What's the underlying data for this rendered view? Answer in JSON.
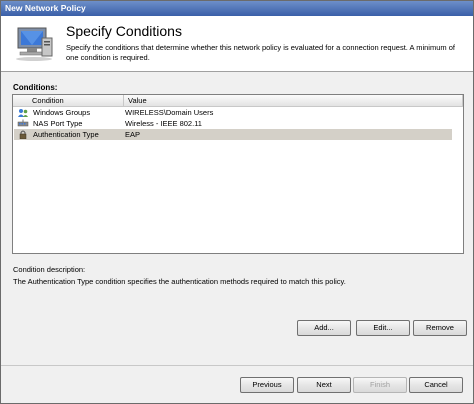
{
  "window": {
    "title": "New Network Policy"
  },
  "header": {
    "title": "Specify Conditions",
    "description": "Specify the conditions that determine whether this network policy is evaluated for a connection request. A minimum of one condition is required."
  },
  "conditions": {
    "label": "Conditions:",
    "columns": [
      "Condition",
      "Value"
    ],
    "rows": [
      {
        "condition": "Windows Groups",
        "value": "WIRELESS\\Domain Users",
        "icon": "users-icon"
      },
      {
        "condition": "NAS Port Type",
        "value": "Wireless - IEEE 802.11",
        "icon": "network-port-icon"
      },
      {
        "condition": "Authentication Type",
        "value": "EAP",
        "icon": "lock-icon",
        "selected": true
      }
    ]
  },
  "description": {
    "label": "Condition description:",
    "text": "The Authentication Type condition specifies the authentication methods required to match this policy."
  },
  "actions": {
    "add": "Add...",
    "edit": "Edit...",
    "remove": "Remove"
  },
  "footer": {
    "previous": "Previous",
    "next": "Next",
    "finish": "Finish",
    "cancel": "Cancel"
  },
  "colors": {
    "title_bar": "#3a5fa8",
    "selected_row": "#d4d0c8"
  }
}
